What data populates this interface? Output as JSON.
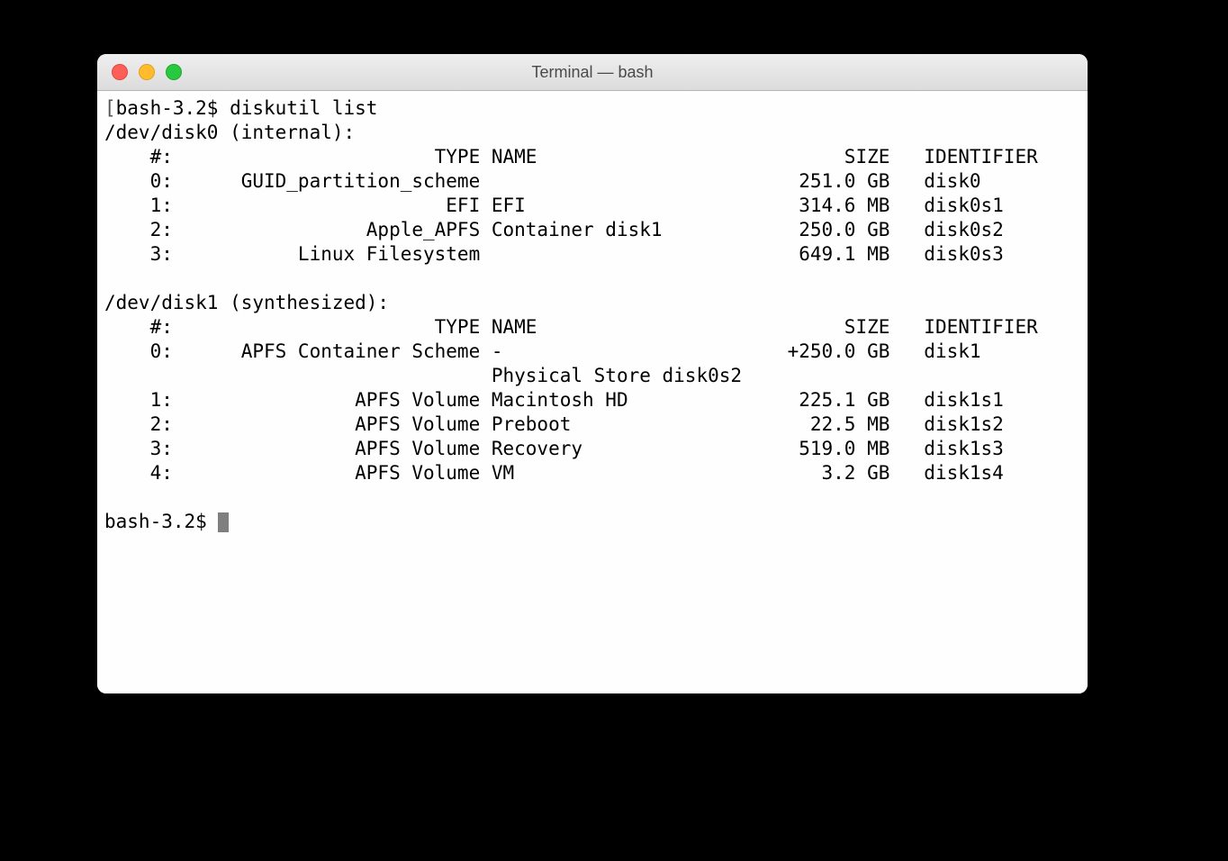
{
  "window": {
    "title": "Terminal — bash"
  },
  "prompt": "bash-3.2$ ",
  "command": "diskutil list",
  "disk0_header": "/dev/disk0 (internal):",
  "disk1_header": "/dev/disk1 (synthesized):",
  "cols": {
    "num": "#:",
    "type": "TYPE",
    "name": "NAME",
    "size": "SIZE",
    "identifier": "IDENTIFIER"
  },
  "disk0_rows": [
    {
      "num": "0:",
      "type": "GUID_partition_scheme",
      "name": "",
      "size": "251.0 GB",
      "identifier": "disk0"
    },
    {
      "num": "1:",
      "type": "EFI",
      "name": "EFI",
      "size": "314.6 MB",
      "identifier": "disk0s1"
    },
    {
      "num": "2:",
      "type": "Apple_APFS",
      "name": "Container disk1",
      "size": "250.0 GB",
      "identifier": "disk0s2"
    },
    {
      "num": "3:",
      "type": "Linux Filesystem",
      "name": "",
      "size": "649.1 MB",
      "identifier": "disk0s3"
    }
  ],
  "disk1_rows": [
    {
      "num": "0:",
      "type": "APFS Container Scheme",
      "name": "-",
      "size": "+250.0 GB",
      "identifier": "disk1",
      "sub": "Physical Store disk0s2"
    },
    {
      "num": "1:",
      "type": "APFS Volume",
      "name": "Macintosh HD",
      "size": "225.1 GB",
      "identifier": "disk1s1"
    },
    {
      "num": "2:",
      "type": "APFS Volume",
      "name": "Preboot",
      "size": "22.5 MB",
      "identifier": "disk1s2"
    },
    {
      "num": "3:",
      "type": "APFS Volume",
      "name": "Recovery",
      "size": "519.0 MB",
      "identifier": "disk1s3"
    },
    {
      "num": "4:",
      "type": "APFS Volume",
      "name": "VM",
      "size": "3.2 GB",
      "identifier": "disk1s4"
    }
  ]
}
